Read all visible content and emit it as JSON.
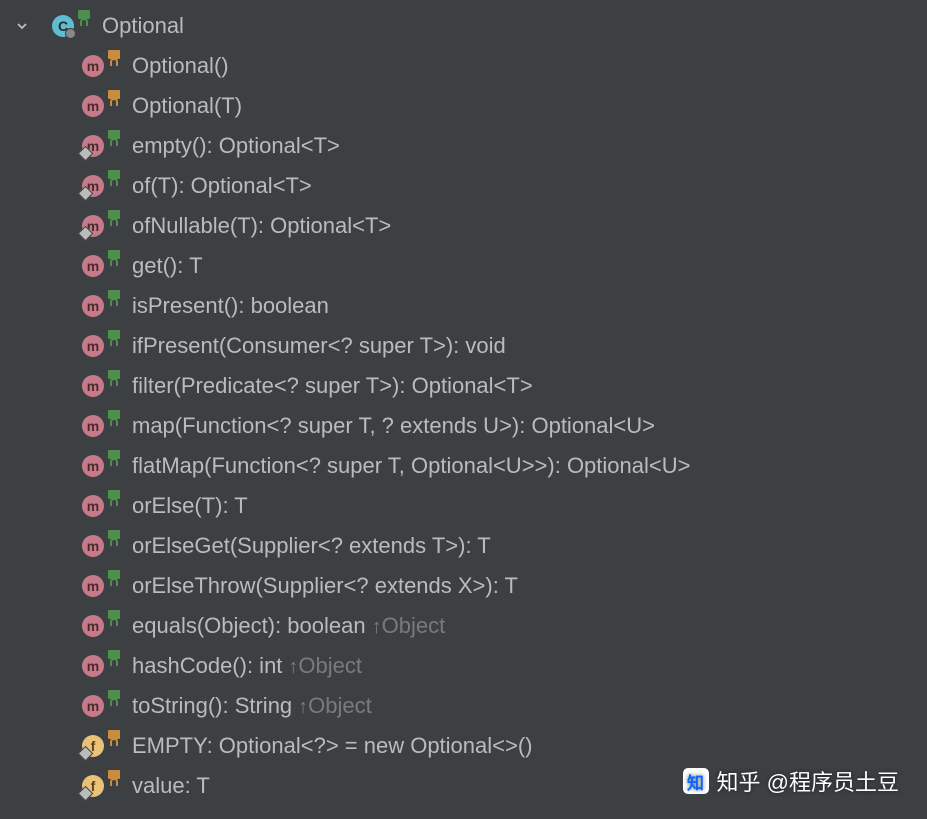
{
  "root": {
    "label": "Optional"
  },
  "members": [
    {
      "badge": "m",
      "corner": false,
      "lock": "orange",
      "sig": "Optional()",
      "inh": ""
    },
    {
      "badge": "m",
      "corner": false,
      "lock": "orange",
      "sig": "Optional(T)",
      "inh": ""
    },
    {
      "badge": "m",
      "corner": true,
      "lock": "green",
      "sig": "empty(): Optional<T>",
      "inh": ""
    },
    {
      "badge": "m",
      "corner": true,
      "lock": "green",
      "sig": "of(T): Optional<T>",
      "inh": ""
    },
    {
      "badge": "m",
      "corner": true,
      "lock": "green",
      "sig": "ofNullable(T): Optional<T>",
      "inh": ""
    },
    {
      "badge": "m",
      "corner": false,
      "lock": "green",
      "sig": "get(): T",
      "inh": ""
    },
    {
      "badge": "m",
      "corner": false,
      "lock": "green",
      "sig": "isPresent(): boolean",
      "inh": ""
    },
    {
      "badge": "m",
      "corner": false,
      "lock": "green",
      "sig": "ifPresent(Consumer<? super T>): void",
      "inh": ""
    },
    {
      "badge": "m",
      "corner": false,
      "lock": "green",
      "sig": "filter(Predicate<? super T>): Optional<T>",
      "inh": ""
    },
    {
      "badge": "m",
      "corner": false,
      "lock": "green",
      "sig": "map(Function<? super T, ? extends U>): Optional<U>",
      "inh": ""
    },
    {
      "badge": "m",
      "corner": false,
      "lock": "green",
      "sig": "flatMap(Function<? super T, Optional<U>>): Optional<U>",
      "inh": ""
    },
    {
      "badge": "m",
      "corner": false,
      "lock": "green",
      "sig": "orElse(T): T",
      "inh": ""
    },
    {
      "badge": "m",
      "corner": false,
      "lock": "green",
      "sig": "orElseGet(Supplier<? extends T>): T",
      "inh": ""
    },
    {
      "badge": "m",
      "corner": false,
      "lock": "green",
      "sig": "orElseThrow(Supplier<? extends X>): T",
      "inh": ""
    },
    {
      "badge": "m",
      "corner": false,
      "lock": "green",
      "sig": "equals(Object): boolean",
      "inh": "Object"
    },
    {
      "badge": "m",
      "corner": false,
      "lock": "green",
      "sig": "hashCode(): int",
      "inh": "Object"
    },
    {
      "badge": "m",
      "corner": false,
      "lock": "green",
      "sig": "toString(): String",
      "inh": "Object"
    },
    {
      "badge": "f",
      "corner": true,
      "lock": "orange",
      "sig": "EMPTY: Optional<?> = new Optional<>()",
      "inh": ""
    },
    {
      "badge": "f",
      "corner": true,
      "lock": "orange",
      "sig": "value: T",
      "inh": ""
    }
  ],
  "watermark": "知乎 @程序员土豆"
}
